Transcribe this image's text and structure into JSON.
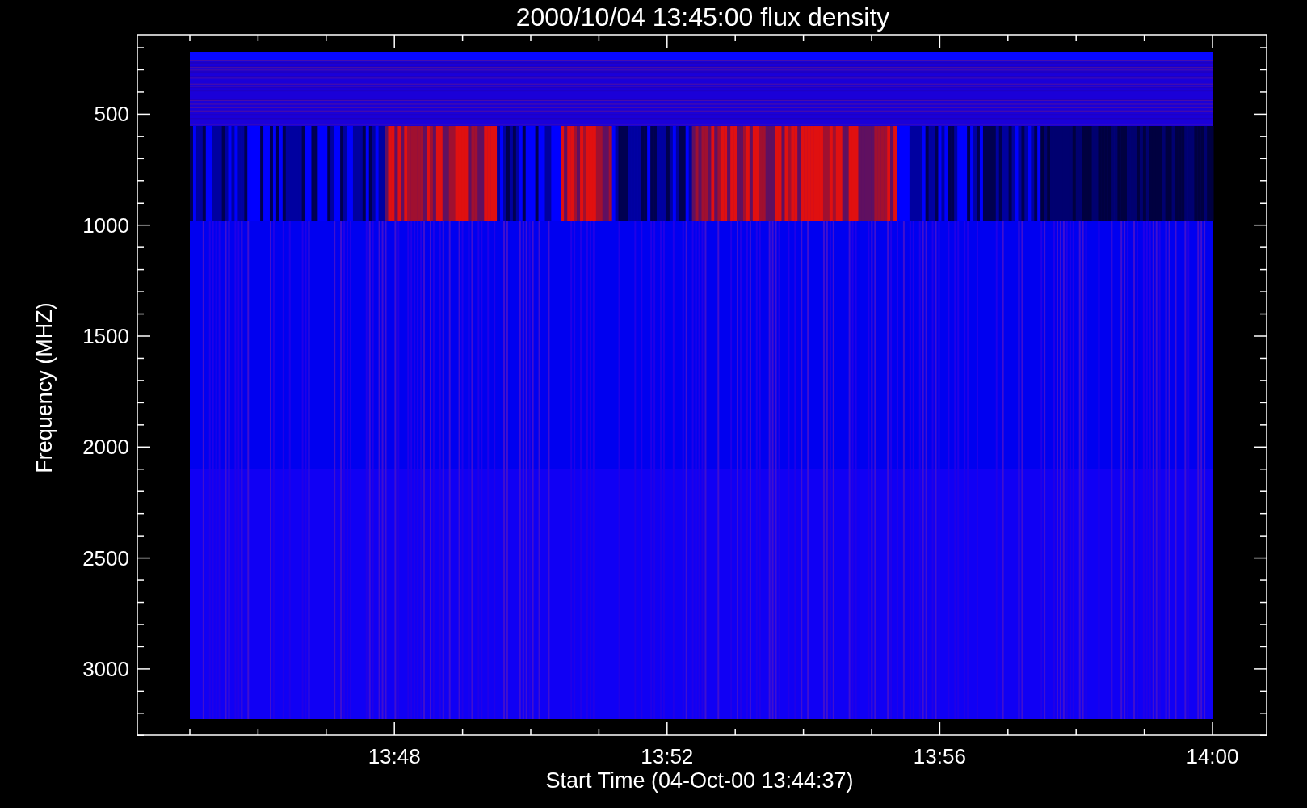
{
  "plot": {
    "title": "2000/10/04 13:45:00 flux density",
    "ylabel": "Frequency (MHZ)",
    "xlabel": "Start Time (04-Oct-00 13:44:37)",
    "y_tick_labels": [
      "500",
      "1000",
      "1500",
      "2000",
      "2500",
      "3000"
    ],
    "x_tick_labels": [
      "13:48",
      "13:52",
      "13:56",
      "14:00"
    ]
  }
}
